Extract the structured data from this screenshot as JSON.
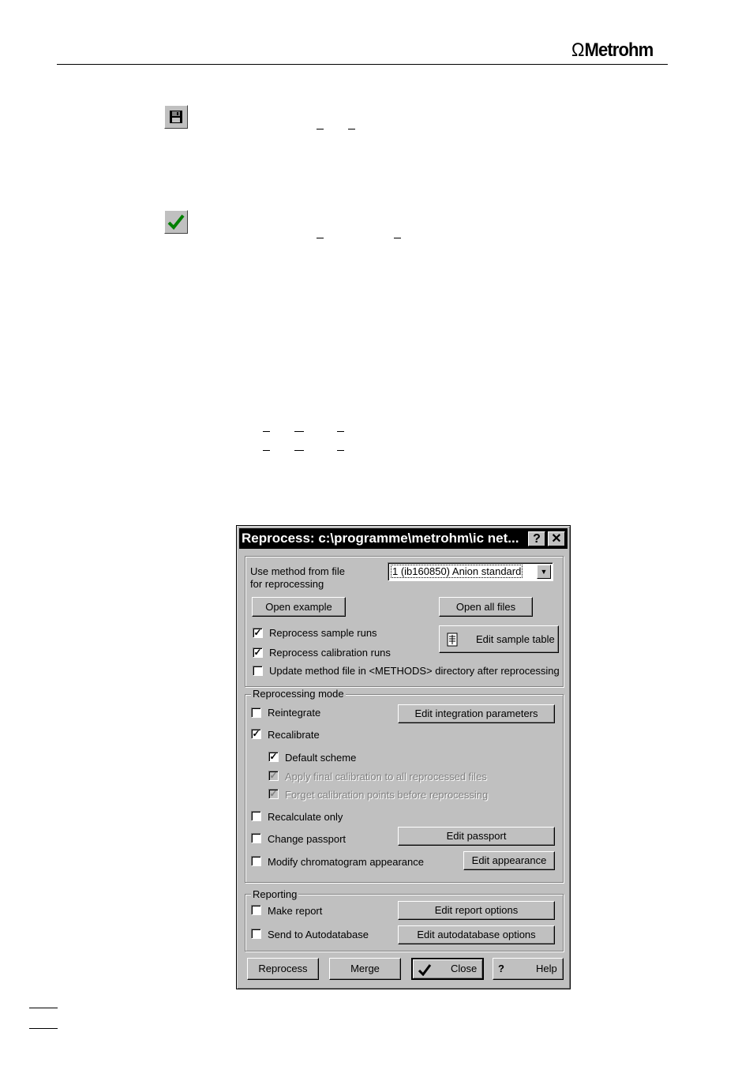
{
  "header": {
    "logo_text": "Metrohm"
  },
  "toolbar_icons": [
    {
      "name": "save-icon"
    },
    {
      "name": "checkmark-icon"
    }
  ],
  "dialog": {
    "title": "Reprocess: c:\\programme\\metrohm\\ic net...",
    "help_glyph": "?",
    "close_glyph": "✕",
    "method_label_line1": "Use method from file",
    "method_label_line2": "for reprocessing",
    "method_value": "1  (ib160850)  Anion standard",
    "open_example": "Open example",
    "open_all_files": "Open all files",
    "reprocess_sample_runs": "Reprocess sample runs",
    "reprocess_calibration_runs": "Reprocess calibration runs",
    "update_method_file": "Update method file in <METHODS> directory after reprocessing",
    "edit_sample_table": "Edit sample table",
    "mode_group": "Reprocessing mode",
    "reintegrate": "Reintegrate",
    "edit_integration_parameters": "Edit integration parameters",
    "recalibrate": "Recalibrate",
    "default_scheme": "Default scheme",
    "apply_final_calibration": "Apply final calibration to all reprocessed files",
    "forget_calibration_points": "Forget calibration points before reprocessing",
    "recalculate_only": "Recalculate only",
    "change_passport": "Change passport",
    "edit_passport": "Edit passport",
    "modify_chromatogram": "Modify chromatogram appearance",
    "edit_appearance": "Edit appearance",
    "reporting_group": "Reporting",
    "make_report": "Make report",
    "edit_report_options": "Edit report options",
    "send_to_autodatabase": "Send to Autodatabase",
    "edit_autodatabase_options": "Edit autodatabase options",
    "reprocess_btn": "Reprocess",
    "merge_btn": "Merge",
    "close_btn": "Close",
    "help_btn": "Help",
    "checkbox_states": {
      "reprocess_sample_runs": true,
      "reprocess_calibration_runs": true,
      "update_method_file": false,
      "reintegrate": false,
      "recalibrate": true,
      "default_scheme": true,
      "apply_final_calibration": true,
      "forget_calibration_points": true,
      "recalculate_only": false,
      "change_passport": false,
      "modify_chromatogram": false,
      "make_report": false,
      "send_to_autodatabase": false
    }
  }
}
